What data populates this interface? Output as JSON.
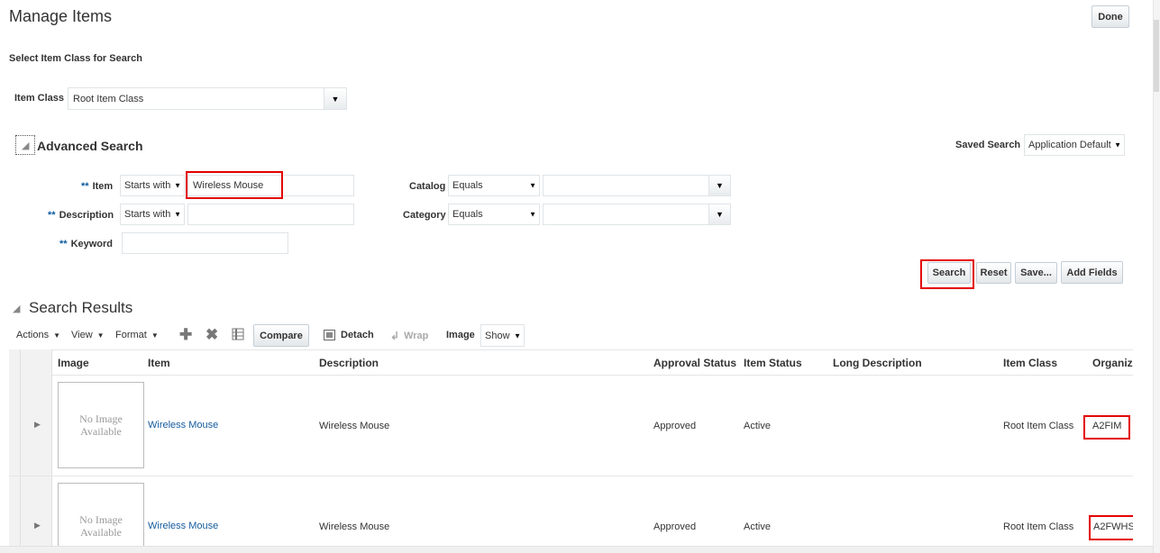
{
  "page": {
    "title": "Manage Items",
    "done_label": "Done",
    "select_class_heading": "Select Item Class for Search",
    "item_class_label": "Item Class",
    "item_class_value": "Root Item Class"
  },
  "advanced_search": {
    "title": "Advanced Search",
    "saved_search_label": "Saved Search",
    "saved_search_value": "Application Default",
    "required_marker": "**",
    "item_label": "Item",
    "item_operator": "Starts with",
    "item_value": "Wireless Mouse",
    "description_label": "Description",
    "description_operator": "Starts with",
    "description_value": "",
    "keyword_label": "Keyword",
    "keyword_value": "",
    "catalog_label": "Catalog",
    "catalog_operator": "Equals",
    "catalog_value": "",
    "category_label": "Category",
    "category_operator": "Equals",
    "category_value": "",
    "buttons": {
      "search": "Search",
      "reset": "Reset",
      "save": "Save...",
      "add_fields": "Add Fields"
    }
  },
  "results": {
    "title": "Search Results",
    "toolbar": {
      "actions": "Actions",
      "view": "View",
      "format": "Format",
      "compare": "Compare",
      "detach": "Detach",
      "wrap": "Wrap",
      "image_label": "Image",
      "image_value": "Show"
    },
    "columns": [
      "Image",
      "Item",
      "Description",
      "Approval Status",
      "Item Status",
      "Long Description",
      "Item Class",
      "Organiza"
    ],
    "rows": [
      {
        "image_text_1": "No Image",
        "image_text_2": "Available",
        "item": "Wireless Mouse",
        "description": "Wireless Mouse",
        "approval_status": "Approved",
        "item_status": "Active",
        "long_description": "",
        "item_class": "Root Item Class",
        "organization": "A2FIM"
      },
      {
        "image_text_1": "No Image",
        "image_text_2": "Available",
        "item": "Wireless Mouse",
        "description": "Wireless Mouse",
        "approval_status": "Approved",
        "item_status": "Active",
        "long_description": "",
        "item_class": "Root Item Class",
        "organization": "A2FWHS"
      }
    ]
  },
  "icons": {
    "collapse": "triangle-collapse-icon",
    "dropdown": "chevron-down-icon",
    "add": "plus-icon",
    "delete": "x-icon",
    "freeze": "freeze-columns-icon",
    "detach": "detach-icon",
    "wrap": "wrap-icon",
    "expand_row": "expand-row-icon"
  },
  "colors": {
    "link": "#145c9e",
    "highlight": "#e30000",
    "required": "#0b5c9f"
  }
}
